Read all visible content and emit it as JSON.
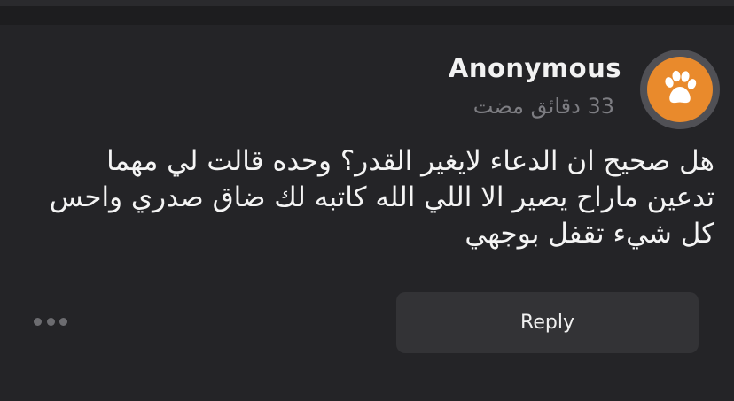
{
  "post": {
    "author": "Anonymous",
    "timestamp": "33 دقائق مضت",
    "message": "هل صحيح ان الدعاء لايغير القدر؟ وحده قالت لي مهما تدعين ماراح يصير الا اللي الله كاتبه لك ضاق صدري واحس كل شيء تقفل بوجهي",
    "avatar_icon": "paw-icon",
    "avatar_color": "#e98a2c"
  },
  "actions": {
    "reply_label": "Reply",
    "more_icon": "more-horizontal-icon"
  }
}
